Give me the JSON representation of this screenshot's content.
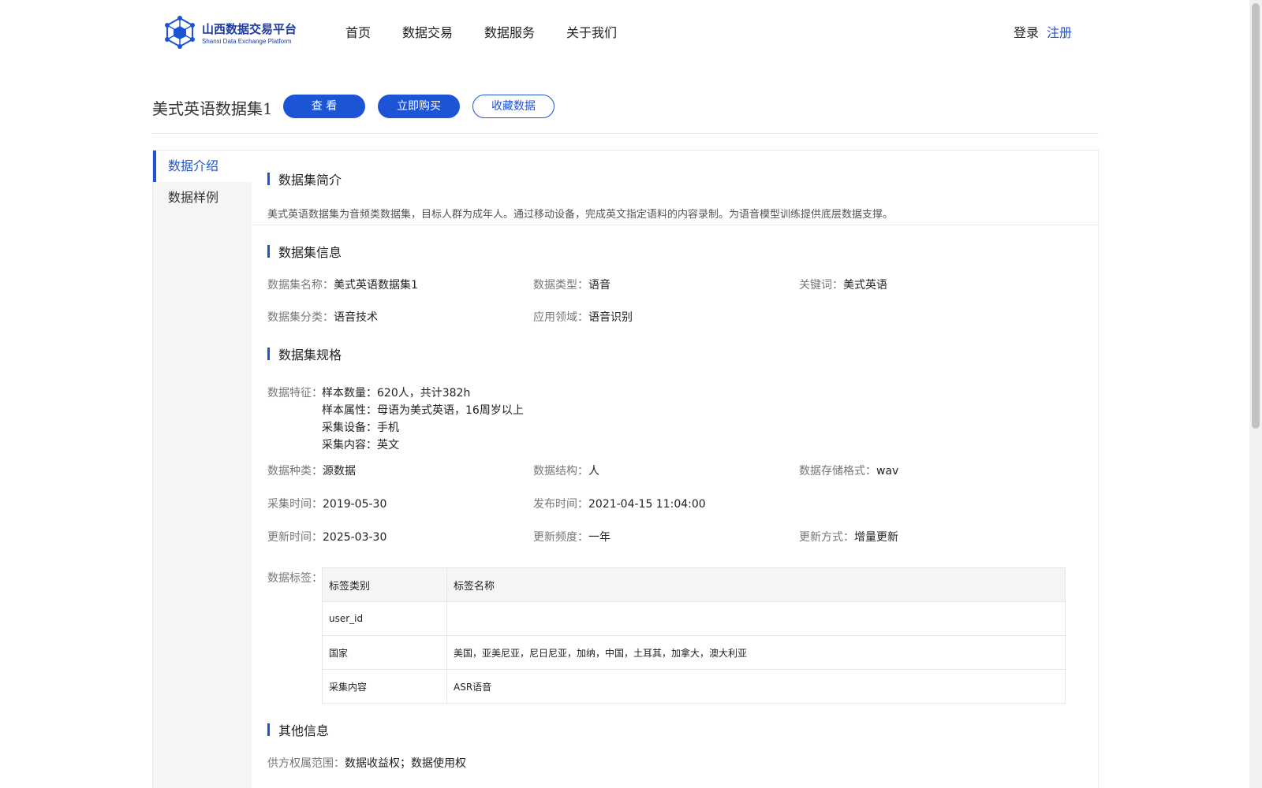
{
  "header": {
    "logo_title": "山西数据交易平台",
    "logo_subtitle": "Shanxi Data Exchange Platform",
    "nav": [
      "首页",
      "数据交易",
      "数据服务",
      "关于我们"
    ],
    "login": "登录",
    "register": "注册"
  },
  "title_row": {
    "title": "美式英语数据集1",
    "view_label": "查 看",
    "buy_label": "立即购买",
    "favorite_label": "收藏数据"
  },
  "sidebar": {
    "items": [
      {
        "label": "数据介绍",
        "active": true
      },
      {
        "label": "数据样例",
        "active": false
      }
    ]
  },
  "intro": {
    "heading": "数据集简介",
    "text": "美式英语数据集为音频类数据集，目标人群为成年人。通过移动设备，完成英文指定语料的内容录制。为语音模型训练提供底层数据支撑。"
  },
  "info": {
    "heading": "数据集信息",
    "name_label": "数据集名称：",
    "name_value": "美式英语数据集1",
    "type_label": "数据类型：",
    "type_value": "语音",
    "keyword_label": "关键词：",
    "keyword_value": "美式英语",
    "category_label": "数据集分类：",
    "category_value": "语音技术",
    "domain_label": "应用领域：",
    "domain_value": "语音识别"
  },
  "spec": {
    "heading": "数据集规格",
    "feature_label": "数据特征：",
    "features": [
      "样本数量：620人，共计382h",
      "样本属性：母语为美式英语，16周岁以上",
      "采集设备：手机",
      "采集内容：英文"
    ],
    "kind_label": "数据种类：",
    "kind_value": "源数据",
    "structure_label": "数据结构：",
    "structure_value": "人",
    "format_label": "数据存储格式：",
    "format_value": "wav",
    "collect_label": "采集时间：",
    "collect_value": "2019-05-30",
    "publish_label": "发布时间：",
    "publish_value": "2021-04-15 11:04:00",
    "update_label": "更新时间：",
    "update_value": "2025-03-30",
    "freq_label": "更新频度：",
    "freq_value": "一年",
    "mode_label": "更新方式：",
    "mode_value": "增量更新",
    "tags_label": "数据标签：",
    "tag_columns": [
      "标签类别",
      "标签名称"
    ],
    "tag_rows": [
      [
        "user_id",
        ""
      ],
      [
        "国家",
        "美国，亚美尼亚，尼日尼亚，加纳，中国，土耳其，加拿大，澳大利亚"
      ],
      [
        "采集内容",
        "ASR语音"
      ]
    ]
  },
  "other": {
    "heading": "其他信息",
    "rights_label": "供方权属范围：",
    "rights_value": "数据收益权；数据使用权"
  },
  "colors": {
    "accent": "#1d54d6",
    "sidebar_bg": "#f5f5f5"
  }
}
